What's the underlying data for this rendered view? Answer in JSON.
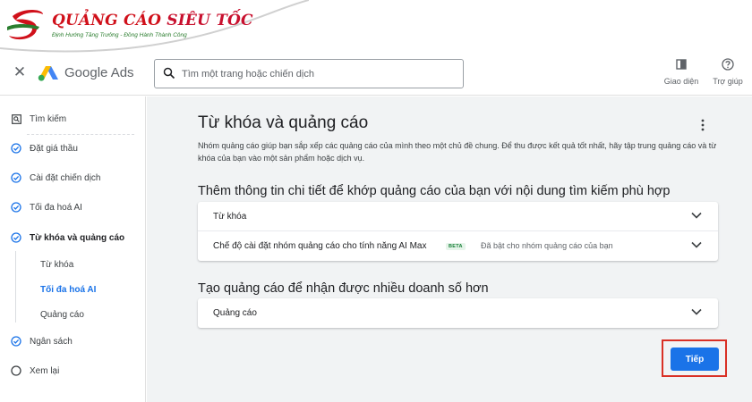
{
  "watermark": {
    "title_part1": "QUẢNG CÁO",
    "title_part2": "SIÊU TỐC",
    "subtitle": "Định Hướng Tăng Trưởng - Đồng Hành Thành Công"
  },
  "topbar": {
    "app_name": "Google Ads",
    "search_placeholder": "Tìm một trang hoặc chiến dịch",
    "appearance_label": "Giao diện",
    "help_label": "Trợ giúp"
  },
  "sidebar": {
    "search": "Tìm kiếm",
    "items": [
      {
        "label": "Đặt giá thầu",
        "status": "done"
      },
      {
        "label": "Cài đặt chiến dịch",
        "status": "done"
      },
      {
        "label": "Tối đa hoá AI",
        "status": "done"
      },
      {
        "label": "Từ khóa và quảng cáo",
        "status": "current"
      },
      {
        "label": "Ngân sách",
        "status": "done"
      },
      {
        "label": "Xem lại",
        "status": "pending"
      }
    ],
    "subitems": [
      {
        "label": "Từ khóa"
      },
      {
        "label": "Tối đa hoá AI",
        "active": true
      },
      {
        "label": "Quảng cáo"
      }
    ]
  },
  "main": {
    "title": "Từ khóa và quảng cáo",
    "description": "Nhóm quảng cáo giúp bạn sắp xếp các quảng cáo của mình theo một chủ đề chung. Để thu được kết quả tốt nhất, hãy tập trung quảng cáo và từ khóa của bạn vào một sản phẩm hoặc dịch vụ.",
    "section1_title": "Thêm thông tin chi tiết để khớp quảng cáo của bạn với nội dung tìm kiếm phù hợp",
    "row_keywords": "Từ khóa",
    "row_ai_max": "Chế độ cài đặt nhóm quảng cáo cho tính năng AI Max",
    "beta": "BETA",
    "row_ai_max_status": "Đã bật cho nhóm quảng cáo của bạn",
    "section2_title": "Tạo quảng cáo để nhận được nhiều doanh số hơn",
    "row_ads": "Quảng cáo",
    "next_button": "Tiếp"
  },
  "colors": {
    "accent": "#1a73e8",
    "highlight": "#d93025"
  }
}
